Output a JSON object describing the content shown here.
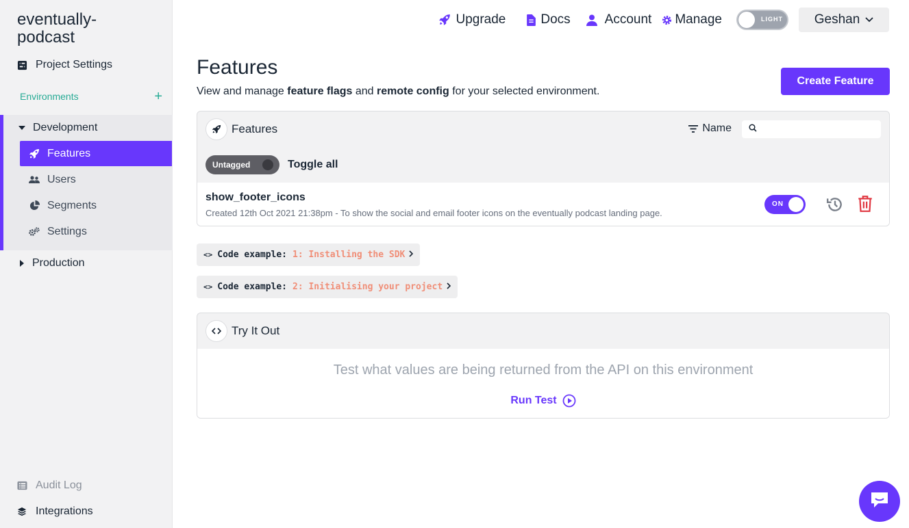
{
  "sidebar": {
    "project_name": "eventually-podcast",
    "project_settings": "Project Settings",
    "environments_label": "Environments",
    "add_symbol": "+",
    "environments": [
      {
        "name": "Development",
        "expanded": true,
        "items": [
          {
            "label": "Features",
            "icon": "rocket-icon",
            "active": true
          },
          {
            "label": "Users",
            "icon": "users-icon"
          },
          {
            "label": "Segments",
            "icon": "pie-chart-icon"
          },
          {
            "label": "Settings",
            "icon": "gears-icon"
          }
        ]
      },
      {
        "name": "Production",
        "expanded": false
      }
    ],
    "audit_log": "Audit Log",
    "integrations": "Integrations"
  },
  "topbar": {
    "upgrade": "Upgrade",
    "docs": "Docs",
    "account": "Account",
    "manage": "Manage",
    "theme_label": "LIGHT",
    "user_name": "Geshan"
  },
  "main": {
    "title": "Features",
    "subtitle_pre": "View and manage ",
    "subtitle_b1": "feature flags",
    "subtitle_mid": " and ",
    "subtitle_b2": "remote config",
    "subtitle_post": " for your selected environment.",
    "create_button": "Create Feature"
  },
  "features_panel": {
    "title": "Features",
    "sort_label": "Name",
    "search_placeholder": "",
    "tag_label": "Untagged",
    "toggle_all": "Toggle all",
    "rows": [
      {
        "name": "show_footer_icons",
        "description": "Created 12th Oct 2021 21:38pm - To show the social and email footer icons on the eventually podcast landing page.",
        "enabled": true,
        "toggle_label": "ON"
      }
    ]
  },
  "code_examples": [
    {
      "prefix": "Code example:",
      "value": "1: Installing the SDK"
    },
    {
      "prefix": "Code example:",
      "value": "2: Initialising your project"
    }
  ],
  "try_it_out": {
    "title": "Try It Out",
    "description": "Test what values are being returned from the API on this environment",
    "run_button": "Run Test"
  },
  "colors": {
    "accent": "#6837fc",
    "teal": "#27ab95",
    "danger": "#e0353f",
    "code_value": "#f08e77"
  }
}
